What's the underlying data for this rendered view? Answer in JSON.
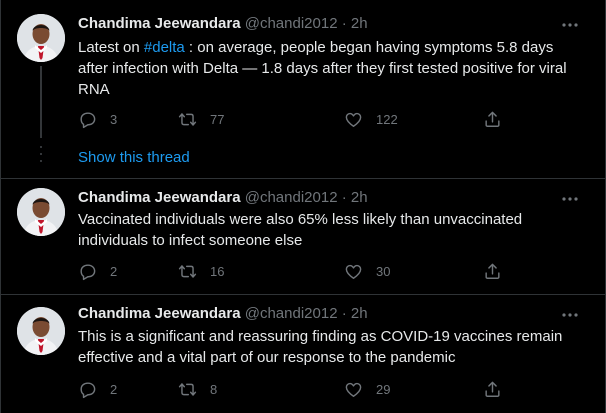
{
  "colors": {
    "background": "#000000",
    "text": "#e7e9ea",
    "muted": "#71767b",
    "accent": "#1d9bf0",
    "border": "#2f3336"
  },
  "show_thread_label": "Show this thread",
  "tweets": [
    {
      "author_name": "Chandima Jeewandara",
      "handle": "@chandi2012",
      "separator": "·",
      "time": "2h",
      "text_before": "Latest on ",
      "hashtag": "#delta",
      "text_after": " : on average, people began having symptoms 5.8 days after infection with Delta — 1.8 days after they first tested positive for viral RNA",
      "replies": "3",
      "retweets": "77",
      "likes": "122",
      "icons": [
        "reply-icon",
        "retweet-icon",
        "like-icon",
        "share-icon",
        "more-icon"
      ]
    },
    {
      "author_name": "Chandima Jeewandara",
      "handle": "@chandi2012",
      "separator": "·",
      "time": "2h",
      "text": "Vaccinated individuals were also 65% less likely than unvaccinated individuals to infect someone else",
      "replies": "2",
      "retweets": "16",
      "likes": "30"
    },
    {
      "author_name": "Chandima Jeewandara",
      "handle": "@chandi2012",
      "separator": "·",
      "time": "2h",
      "text": "This is a significant and reassuring finding as COVID-19 vaccines remain effective and a vital part of our response to the pandemic",
      "replies": "2",
      "retweets": "8",
      "likes": "29"
    }
  ]
}
